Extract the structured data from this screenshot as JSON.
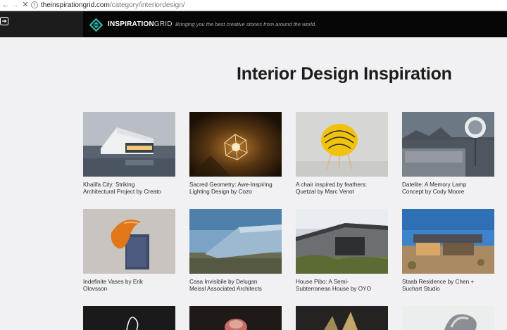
{
  "browser": {
    "url_domain": "theinspirationgrid.com",
    "url_path": "/category/interiordesign/"
  },
  "header": {
    "brand_bold": "INSPIRATION",
    "brand_light": "GRID",
    "tagline": "Bringing you the best creative stories from around the world."
  },
  "page": {
    "title": "Interior Design Inspiration"
  },
  "cards": [
    {
      "line1": "Khalifa City: Striking",
      "line2": "Architectural Project by Creato"
    },
    {
      "line1": "Sacred Geometry: Awe-Inspiring",
      "line2": "Lighting Design by Cozo"
    },
    {
      "line1": "A chair inspired by feathers:",
      "line2": "Quetzal by Marc Venot"
    },
    {
      "line1": "Datelite: A Memory Lamp",
      "line2": "Concept by Cody Moore"
    },
    {
      "line1": "Indefinite Vases by Erik",
      "line2": "Olovsson"
    },
    {
      "line1": "Casa Invisibile by Delugan",
      "line2": "Meissl Associated Architects"
    },
    {
      "line1": "House Pibo: A Semi-",
      "line2": "Subterranean House by OYO"
    },
    {
      "line1": "Staab Residence by Chen +",
      "line2": "Suchart Studio"
    }
  ],
  "colors": {
    "accent": "#2bb7a7",
    "header_bg": "#060606",
    "page_bg": "#f1f1f3"
  }
}
